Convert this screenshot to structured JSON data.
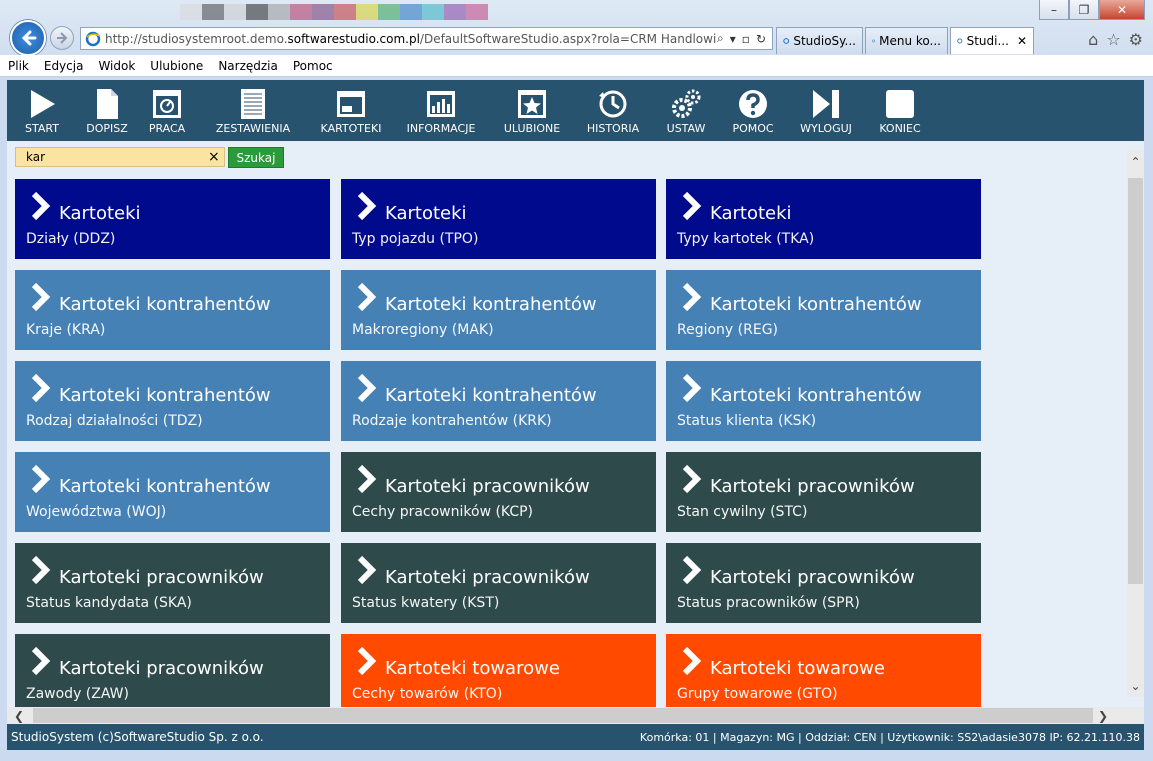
{
  "browser": {
    "address_url_prefix": "http://studiosystemroot.demo.",
    "address_url_domain": "softwarestudio.com.pl",
    "address_url_path": "/DefaultSoftwareStudio.aspx?rola=CRM Handlowiec&rolasy",
    "tabs": [
      {
        "label": "StudioSy..."
      },
      {
        "label": "Menu ko..."
      },
      {
        "label": "Studi..."
      }
    ],
    "menu": [
      "Plik",
      "Edycja",
      "Widok",
      "Ulubione",
      "Narzędzia",
      "Pomoc"
    ]
  },
  "toolbar": [
    {
      "label": "START",
      "icon": "play-icon"
    },
    {
      "label": "DOPISZ",
      "icon": "new-document-icon"
    },
    {
      "label": "PRACA",
      "icon": "work-monitor-icon"
    },
    {
      "label": "ZESTAWIENIA",
      "icon": "report-icon"
    },
    {
      "label": "KARTOTEKI",
      "icon": "window-icon"
    },
    {
      "label": "INFORMACJE",
      "icon": "bar-chart-icon"
    },
    {
      "label": "ULUBIONE",
      "icon": "star-icon"
    },
    {
      "label": "HISTORIA",
      "icon": "history-icon"
    },
    {
      "label": "USTAW",
      "icon": "gears-icon"
    },
    {
      "label": "POMOC",
      "icon": "help-icon"
    },
    {
      "label": "WYLOGUJ",
      "icon": "logout-icon"
    },
    {
      "label": "KONIEC",
      "icon": "end-icon"
    }
  ],
  "search": {
    "value": "kar",
    "clear": "×",
    "button_label": "Szukaj"
  },
  "colors": {
    "navy": "#000a8c",
    "steel": "#4581b4",
    "slate": "#2f4a4b",
    "orange": "#ff4a00"
  },
  "tiles": [
    {
      "title": "Kartoteki",
      "subtitle": "Działy (DDZ)",
      "color": "#000a8c"
    },
    {
      "title": "Kartoteki",
      "subtitle": "Typ pojazdu (TPO)",
      "color": "#000a8c"
    },
    {
      "title": "Kartoteki",
      "subtitle": "Typy kartotek (TKA)",
      "color": "#000a8c"
    },
    {
      "title": "Kartoteki kontrahentów",
      "subtitle": "Kraje (KRA)",
      "color": "#4581b4"
    },
    {
      "title": "Kartoteki kontrahentów",
      "subtitle": "Makroregiony (MAK)",
      "color": "#4581b4"
    },
    {
      "title": "Kartoteki kontrahentów",
      "subtitle": "Regiony (REG)",
      "color": "#4581b4"
    },
    {
      "title": "Kartoteki kontrahentów",
      "subtitle": "Rodzaj działalności (TDZ)",
      "color": "#4581b4"
    },
    {
      "title": "Kartoteki kontrahentów",
      "subtitle": "Rodzaje kontrahentów (KRK)",
      "color": "#4581b4"
    },
    {
      "title": "Kartoteki kontrahentów",
      "subtitle": "Status klienta (KSK)",
      "color": "#4581b4"
    },
    {
      "title": "Kartoteki kontrahentów",
      "subtitle": "Województwa (WOJ)",
      "color": "#4581b4"
    },
    {
      "title": "Kartoteki pracowników",
      "subtitle": "Cechy pracowników (KCP)",
      "color": "#2f4a4b"
    },
    {
      "title": "Kartoteki pracowników",
      "subtitle": "Stan cywilny (STC)",
      "color": "#2f4a4b"
    },
    {
      "title": "Kartoteki pracowników",
      "subtitle": "Status kandydata (SKA)",
      "color": "#2f4a4b"
    },
    {
      "title": "Kartoteki pracowników",
      "subtitle": "Status kwatery (KST)",
      "color": "#2f4a4b"
    },
    {
      "title": "Kartoteki pracowników",
      "subtitle": "Status pracowników (SPR)",
      "color": "#2f4a4b"
    },
    {
      "title": "Kartoteki pracowników",
      "subtitle": "Zawody (ZAW)",
      "color": "#2f4a4b"
    },
    {
      "title": "Kartoteki towarowe",
      "subtitle": "Cechy towarów (KTO)",
      "color": "#ff4a00"
    },
    {
      "title": "Kartoteki towarowe",
      "subtitle": "Grupy towarowe (GTO)",
      "color": "#ff4a00"
    }
  ],
  "status": {
    "left": "StudioSystem (c)SoftwareStudio Sp. z o.o.",
    "right": "Komórka: 01 | Magazyn: MG | Oddział: CEN | Użytkownik: SS2\\adasie3078 IP: 62.21.110.38"
  }
}
